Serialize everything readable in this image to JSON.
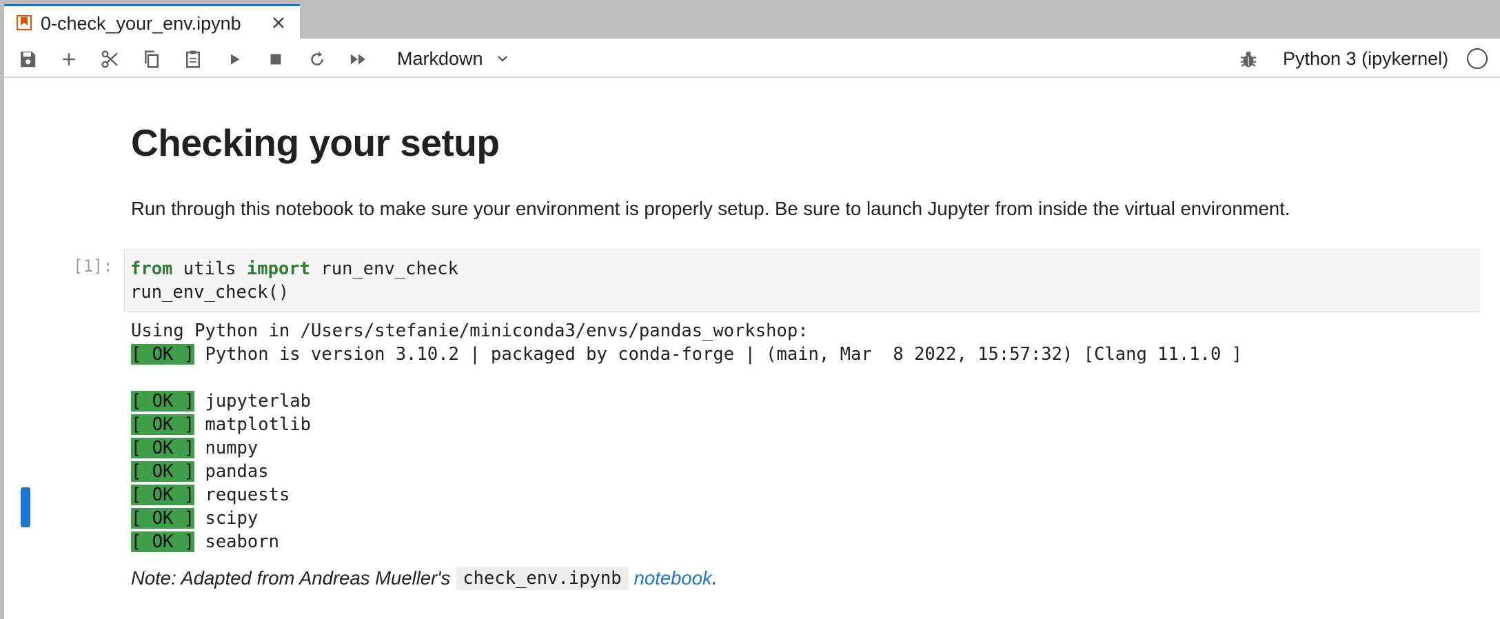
{
  "tab": {
    "title": "0-check_your_env.ipynb",
    "icon": "notebook-icon",
    "accent": "#1976d2"
  },
  "toolbar": {
    "buttons": [
      "save-icon",
      "add-cell-icon",
      "cut-icon",
      "copy-icon",
      "paste-icon",
      "run-icon",
      "stop-icon",
      "restart-icon",
      "run-all-icon"
    ],
    "cell_type": "Markdown",
    "kernel": "Python 3 (ipykernel)"
  },
  "notebook": {
    "title": "Checking your setup",
    "intro": "Run through this notebook to make sure your environment is properly setup. Be sure to launch Jupyter from inside the virtual environment.",
    "code_cell": {
      "prompt": "[1]:",
      "line1_kw1": "from",
      "line1_mid": " utils ",
      "line1_kw2": "import",
      "line1_rest": " run_env_check",
      "line2": "run_env_check()"
    },
    "output": {
      "python_path": "Using Python in /Users/stefanie/miniconda3/envs/pandas_workshop:",
      "ok_label": "[ OK ]",
      "python_version": " Python is version 3.10.2 | packaged by conda-forge | (main, Mar  8 2022, 15:57:32) [Clang 11.1.0 ]",
      "packages": [
        " jupyterlab",
        " matplotlib",
        " numpy",
        " pandas",
        " requests",
        " scipy",
        " seaborn"
      ],
      "ok_color": "#3f9e4a"
    },
    "note": {
      "prefix": "Note: Adapted from Andreas Mueller's",
      "code": "check_env.ipynb",
      "link": "notebook",
      "suffix": "."
    }
  }
}
